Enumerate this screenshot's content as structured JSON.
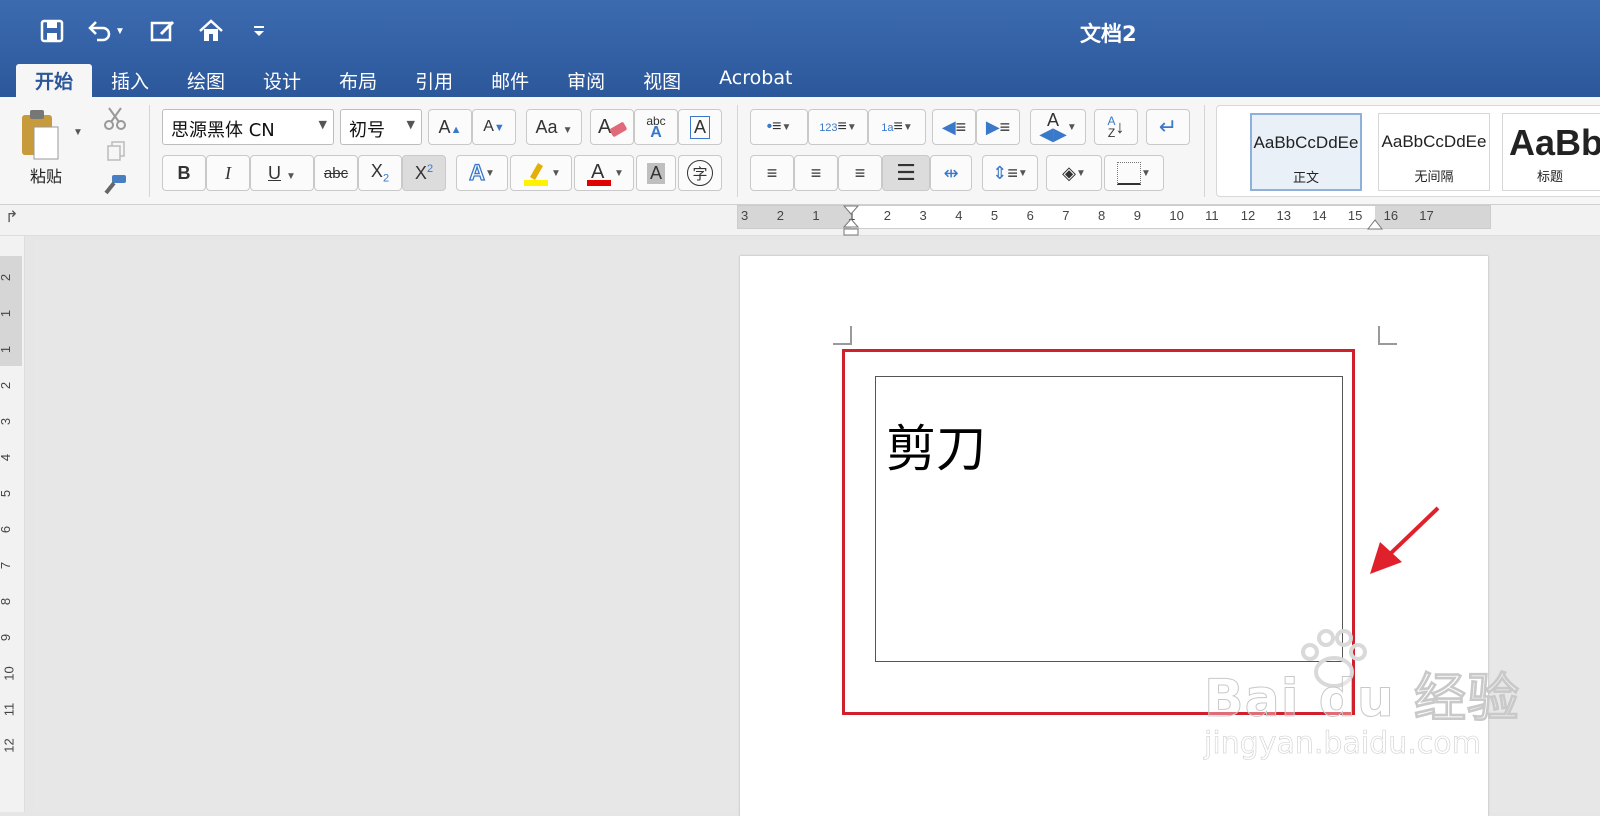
{
  "window": {
    "title": "文档2"
  },
  "tabs": [
    "开始",
    "插入",
    "绘图",
    "设计",
    "布局",
    "引用",
    "邮件",
    "审阅",
    "视图",
    "Acrobat"
  ],
  "ribbon": {
    "paste_label": "粘贴",
    "font_name": "思源黑体 CN",
    "font_size": "初号",
    "styles": [
      {
        "sample": "AaBbCcDdEe",
        "name": "正文"
      },
      {
        "sample": "AaBbCcDdEe",
        "name": "无间隔"
      },
      {
        "sample": "AaBb",
        "name": "标题"
      }
    ]
  },
  "rulers": {
    "horizontal": [
      "3",
      "2",
      "1",
      "1",
      "2",
      "3",
      "4",
      "5",
      "6",
      "7",
      "8",
      "9",
      "10",
      "11",
      "12",
      "13",
      "14",
      "15",
      "16",
      "17"
    ],
    "vertical": [
      "2",
      "1",
      "1",
      "2",
      "3",
      "4",
      "5",
      "6",
      "7",
      "8",
      "9",
      "10",
      "11",
      "12"
    ]
  },
  "document": {
    "textbox_text": "剪刀"
  },
  "watermark": {
    "brand": "Bai du 经验",
    "url": "jingyan.baidu.com"
  },
  "colors": {
    "titlebar": "#2b579a",
    "highlight": "#d0202b",
    "arrow": "#e0202b"
  }
}
